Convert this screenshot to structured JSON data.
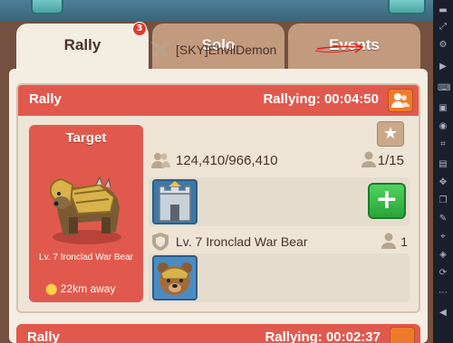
{
  "tabs": [
    {
      "label": "Rally",
      "badge": "3"
    },
    {
      "label": "Solo"
    },
    {
      "label": "Events"
    }
  ],
  "rally_card": {
    "title": "Rally",
    "timer": "Rallying: 00:04:50",
    "target_title": "Target",
    "target_name": "Lv. 7 Ironclad War Bear",
    "distance": "22km away",
    "leader": "[SKY]EhvilDemon",
    "troops": "124,410/966,410",
    "members": "1/15",
    "target_row_name": "Lv. 7 Ironclad War Bear",
    "target_row_count": "1"
  },
  "second_card": {
    "title": "Rally",
    "timer": "Rallying: 00:02:37"
  },
  "icons": {
    "star": "star-icon",
    "swords": "crossed-swords-icon",
    "group": "group-icon",
    "add": "plus-icon",
    "shield": "shield-icon",
    "pin": "location-pin-icon"
  },
  "colors": {
    "header_red": "#e1594d",
    "add_green": "#2ba33a",
    "annotation_red": "#e0201a"
  }
}
